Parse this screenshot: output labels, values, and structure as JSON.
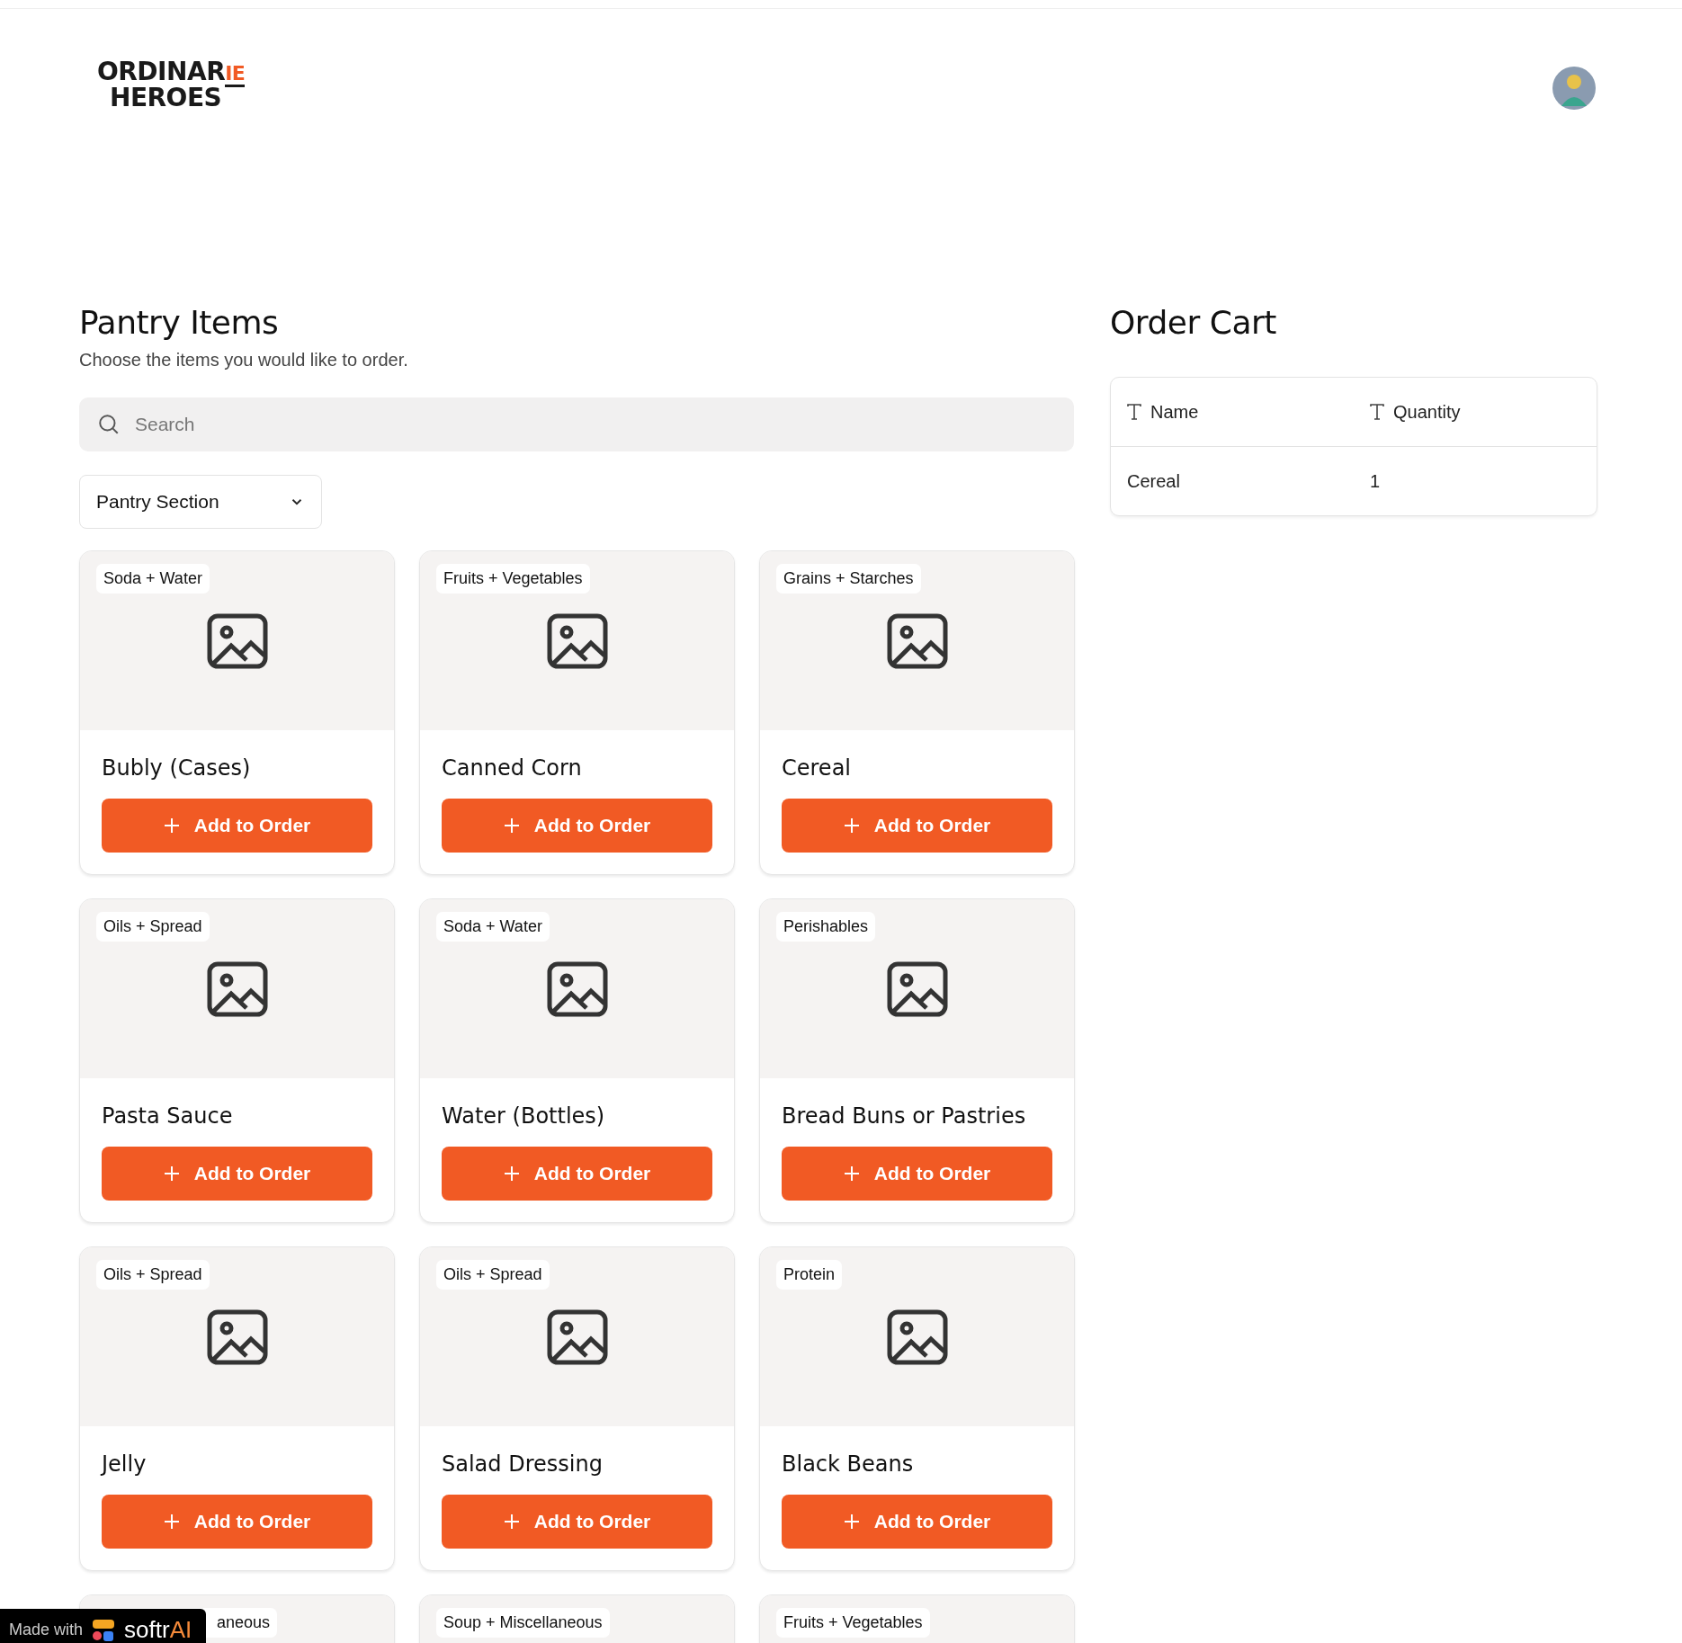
{
  "logo": {
    "line_1": "ORDINAR",
    "accent": "IE",
    "line_2": "HEROES"
  },
  "pantry": {
    "title": "Pantry Items",
    "subtitle": "Choose the items you would like to order.",
    "search": {
      "placeholder": "Search"
    },
    "filter": {
      "label": "Pantry Section"
    },
    "items": [
      {
        "tag": "Soda + Water",
        "name": "Bubly (Cases)",
        "button": "Add to Order"
      },
      {
        "tag": "Fruits + Vegetables",
        "name": "Canned Corn",
        "button": "Add to Order"
      },
      {
        "tag": "Grains + Starches",
        "name": "Cereal",
        "button": "Add to Order"
      },
      {
        "tag": "Oils + Spread",
        "name": "Pasta Sauce",
        "button": "Add to Order"
      },
      {
        "tag": "Soda + Water",
        "name": "Water (Bottles)",
        "button": "Add to Order"
      },
      {
        "tag": "Perishables",
        "name": "Bread Buns or Pastries",
        "button": "Add to Order"
      },
      {
        "tag": "Oils + Spread",
        "name": "Jelly",
        "button": "Add to Order"
      },
      {
        "tag": "Oils + Spread",
        "name": "Salad  Dressing",
        "button": "Add to Order"
      },
      {
        "tag": "Protein",
        "name": "Black Beans",
        "button": "Add to Order"
      },
      {
        "tag": "aneous",
        "covered": true
      },
      {
        "tag": "Soup + Miscellaneous"
      },
      {
        "tag": "Fruits + Vegetables"
      }
    ]
  },
  "cart": {
    "title": "Order Cart",
    "columns": [
      "Name",
      "Quantity"
    ],
    "rows": [
      [
        "Cereal",
        "1"
      ]
    ]
  },
  "badge": {
    "prefix": "Made with",
    "brand": "softr",
    "brand_suffix": "AI"
  }
}
